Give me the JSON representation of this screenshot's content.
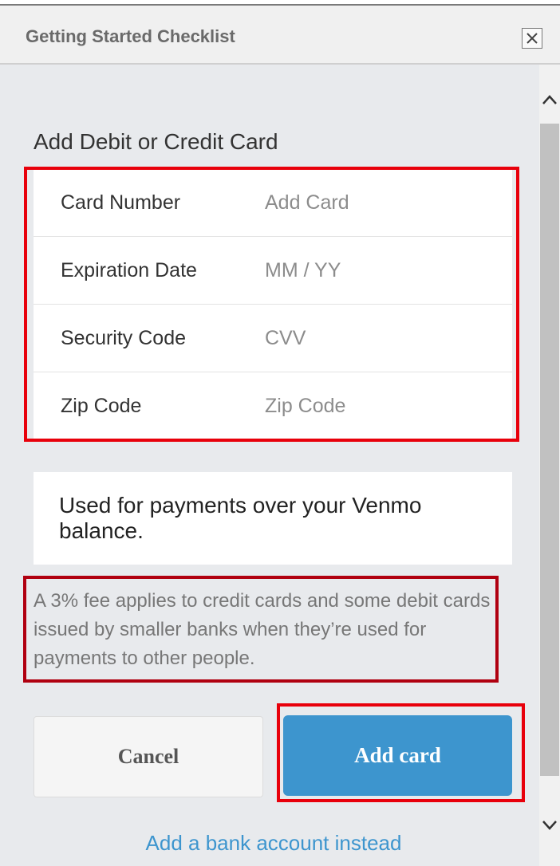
{
  "header": {
    "title": "Getting Started Checklist",
    "close_icon": "close-icon"
  },
  "section": {
    "title": "Add Debit or Credit Card"
  },
  "form": {
    "fields": [
      {
        "label": "Card Number",
        "placeholder": "Add Card"
      },
      {
        "label": "Expiration Date",
        "placeholder": "MM / YY"
      },
      {
        "label": "Security Code",
        "placeholder": "CVV"
      },
      {
        "label": "Zip Code",
        "placeholder": "Zip Code"
      }
    ]
  },
  "info": {
    "text": "Used for payments over your Venmo balance."
  },
  "fee": {
    "text": "A 3% fee applies to credit cards and some debit cards issued by smaller banks when they’re used for payments to other people."
  },
  "actions": {
    "cancel_label": "Cancel",
    "add_label": "Add card"
  },
  "alt_link": {
    "label": "Add a bank account instead"
  },
  "colors": {
    "accent": "#3d95ce",
    "highlight": "#e8000b",
    "highlight_dark": "#b00010",
    "panel_bg": "#e8eaed"
  }
}
